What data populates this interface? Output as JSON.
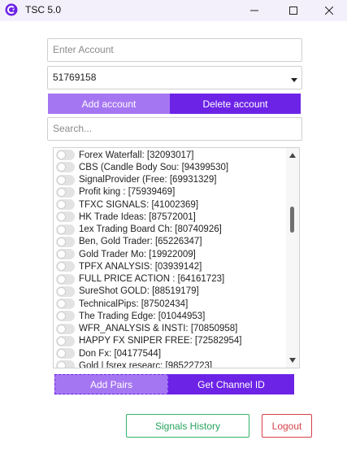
{
  "window": {
    "title": "TSC 5.0",
    "icon": "tsc-logo-icon",
    "controls": [
      "minimize-icon",
      "maximize-icon",
      "close-icon"
    ]
  },
  "account": {
    "placeholder": "Enter Account",
    "selected": "51769158",
    "add_label": "Add account",
    "delete_label": "Delete account"
  },
  "search": {
    "placeholder": "Search..."
  },
  "channels": [
    "Forex Waterfall: [32093017]",
    "CBS (Candle Body Sou: [94399530]",
    "SignalProvider (Free: [69931329]",
    "Profit king  : [75939469]",
    "TFXC SIGNALS: [41002369]",
    "HK Trade Ideas: [87572001]",
    "1ex Trading Board Ch: [80740926]",
    "Ben, Gold Trader: [65226347]",
    "Gold Trader Mo: [19922009]",
    "TPFX ANALYSIS: [03939142]",
    "FULL PRICE ACTION : [64161723]",
    "SureShot GOLD: [88519179]",
    "TechnicalPips: [87502434]",
    "The Trading Edge: [01044953]",
    "WFR_ANALYSIS & INSTI: [70850958]",
    "HAPPY FX SNIPER FREE: [72582954]",
    "Don Fx: [04177544]",
    "Gold | fsrex researc: [98522723]"
  ],
  "actions": {
    "add_pairs": "Add Pairs",
    "get_channel_id": "Get Channel ID",
    "signals_history": "Signals History",
    "logout": "Logout"
  },
  "colors": {
    "accent": "#6c23e6",
    "accent_light": "#a576f2",
    "success": "#26a35e",
    "danger": "#d6424a",
    "titlebar": "#f4f0fb"
  }
}
